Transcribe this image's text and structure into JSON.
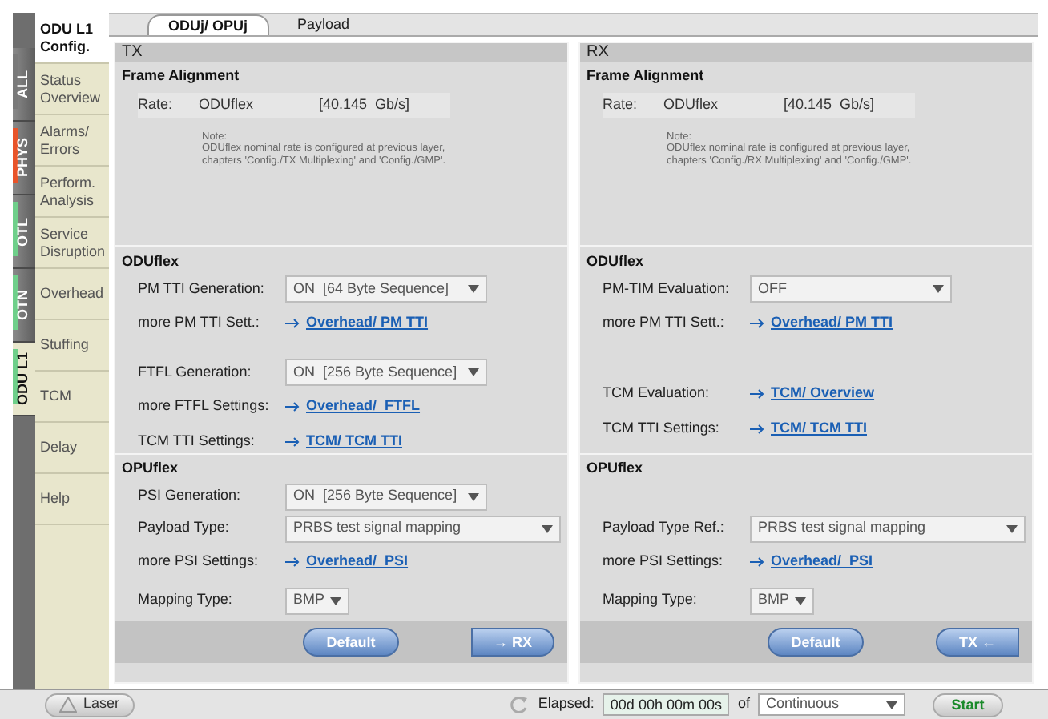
{
  "side_tabs": [
    {
      "label": "ALL",
      "selected": false,
      "color": "#7a7a7a"
    },
    {
      "label": "PHYS",
      "selected": false,
      "color": "#e8542a"
    },
    {
      "label": "OTL",
      "selected": false,
      "color": "#6fcf8a"
    },
    {
      "label": "OTN",
      "selected": false,
      "color": "#6fcf8a"
    },
    {
      "label": "ODU L1",
      "selected": true,
      "color": "#6fcf8a"
    }
  ],
  "menu": [
    {
      "label": "ODU L1 Config.",
      "selected": true
    },
    {
      "label": "Status Overview",
      "selected": false
    },
    {
      "label": "Alarms/ Errors",
      "selected": false
    },
    {
      "label": "Perform. Analysis",
      "selected": false
    },
    {
      "label": "Service Disruption",
      "selected": false
    },
    {
      "label": "Overhead",
      "selected": false
    },
    {
      "label": "Stuffing",
      "selected": false
    },
    {
      "label": "TCM",
      "selected": false
    },
    {
      "label": "Delay",
      "selected": false
    },
    {
      "label": "Help",
      "selected": false
    }
  ],
  "tabs": [
    {
      "label": "ODUj/ OPUj",
      "selected": true
    },
    {
      "label": "Payload",
      "selected": false
    }
  ],
  "columns": [
    {
      "title": "TX",
      "frame": {
        "title": "Frame Alignment",
        "rate_label": "Rate:",
        "rate_value": "ODUflex",
        "rate_unit": "[40.145  Gb/s]",
        "note": "Note:\nODUflex nominal rate is configured at previous layer,\nchapters 'Config./TX Multiplexing'  and  'Config./GMP'."
      },
      "oduflex": {
        "title": "ODUflex",
        "groups": [
          [
            {
              "kind": "select",
              "label": "PM TTI Generation:",
              "value": "ON  [64 Byte Sequence]"
            },
            {
              "kind": "link",
              "label": "more PM TTI Sett.:",
              "value": "Overhead/ PM TTI"
            }
          ],
          [
            {
              "kind": "select",
              "label": "FTFL Generation:",
              "value": "ON  [256 Byte Sequence]"
            },
            {
              "kind": "link",
              "label": "more FTFL Settings:",
              "value": "Overhead/  FTFL"
            }
          ],
          [
            {
              "kind": "link",
              "label": "TCM TTI Settings:",
              "value": "TCM/ TCM TTI"
            }
          ]
        ]
      },
      "opuflex": {
        "title": "OPUflex",
        "rows": [
          {
            "kind": "select",
            "label": "PSI Generation:",
            "value": "ON  [256 Byte Sequence]"
          },
          {
            "kind": "longselect",
            "label": "Payload Type:",
            "value": "PRBS test signal mapping"
          },
          {
            "kind": "link",
            "label": "more PSI Settings:",
            "value": "Overhead/  PSI"
          },
          {
            "kind": "shortselect",
            "label": "Mapping Type:",
            "value": "BMP"
          }
        ]
      },
      "buttons": [
        {
          "kind": "default",
          "label": "Default"
        },
        {
          "kind": "right",
          "label": "→ RX"
        }
      ]
    },
    {
      "title": "RX",
      "frame": {
        "title": "Frame Alignment",
        "rate_label": "Rate:",
        "rate_value": "ODUflex",
        "rate_unit": "[40.145  Gb/s]",
        "note": "Note:\nODUflex nominal rate is configured at previous layer,\nchapters 'Config./RX Multiplexing'  and  'Config./GMP'."
      },
      "oduflex": {
        "title": "ODUflex",
        "groups": [
          [
            {
              "kind": "select",
              "label": "PM-TIM Evaluation:",
              "value": "OFF"
            },
            {
              "kind": "link",
              "label": "more PM TTI Sett.:",
              "value": "Overhead/ PM TTI"
            }
          ],
          [
            {
              "kind": "link",
              "label": "TCM Evaluation:",
              "value": "TCM/ Overview"
            },
            {
              "kind": "link",
              "label": "TCM TTI Settings:",
              "value": "TCM/ TCM TTI"
            }
          ]
        ]
      },
      "opuflex": {
        "title": "OPUflex",
        "rows": [
          {
            "kind": "longselect",
            "label": "Payload Type Ref.:",
            "value": "PRBS test signal mapping"
          },
          {
            "kind": "link",
            "label": "more PSI Settings:",
            "value": "Overhead/  PSI"
          },
          {
            "kind": "shortselect",
            "label": "Mapping Type:",
            "value": "BMP"
          }
        ]
      },
      "buttons": [
        {
          "kind": "default",
          "label": "Default"
        },
        {
          "kind": "left",
          "label": "TX ←"
        }
      ]
    }
  ],
  "status_bar": {
    "laser": "Laser",
    "elapsed_label": "Elapsed:",
    "elapsed": "00d 00h 00m 00s",
    "of": "of",
    "mode": "Continuous",
    "start": "Start"
  }
}
